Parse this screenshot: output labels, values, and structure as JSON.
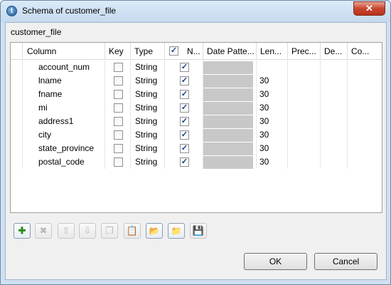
{
  "window": {
    "title": "Schema of customer_file",
    "close_label": "✕"
  },
  "section_label": "customer_file",
  "table": {
    "headers": [
      "Column",
      "Key",
      "Type",
      "N...",
      "Date Patte...",
      "Len...",
      "Prec...",
      "De...",
      "Co..."
    ],
    "header_checkbox_checked": true,
    "rows": [
      {
        "column": "account_num",
        "key": false,
        "type": "String",
        "nullable": true,
        "date_pattern": "",
        "length": "",
        "precision": "",
        "default": "",
        "comment": ""
      },
      {
        "column": "lname",
        "key": false,
        "type": "String",
        "nullable": true,
        "date_pattern": "",
        "length": "30",
        "precision": "",
        "default": "",
        "comment": ""
      },
      {
        "column": "fname",
        "key": false,
        "type": "String",
        "nullable": true,
        "date_pattern": "",
        "length": "30",
        "precision": "",
        "default": "",
        "comment": ""
      },
      {
        "column": "mi",
        "key": false,
        "type": "String",
        "nullable": true,
        "date_pattern": "",
        "length": "30",
        "precision": "",
        "default": "",
        "comment": ""
      },
      {
        "column": "address1",
        "key": false,
        "type": "String",
        "nullable": true,
        "date_pattern": "",
        "length": "30",
        "precision": "",
        "default": "",
        "comment": ""
      },
      {
        "column": "city",
        "key": false,
        "type": "String",
        "nullable": true,
        "date_pattern": "",
        "length": "30",
        "precision": "",
        "default": "",
        "comment": ""
      },
      {
        "column": "state_province",
        "key": false,
        "type": "String",
        "nullable": true,
        "date_pattern": "",
        "length": "30",
        "precision": "",
        "default": "",
        "comment": ""
      },
      {
        "column": "postal_code",
        "key": false,
        "type": "String",
        "nullable": true,
        "date_pattern": "",
        "length": "30",
        "precision": "",
        "default": "",
        "comment": ""
      }
    ]
  },
  "toolbar": {
    "buttons": [
      {
        "icon": "add-icon",
        "glyph": "✚",
        "enabled": true
      },
      {
        "icon": "remove-icon",
        "glyph": "✖",
        "enabled": false
      },
      {
        "icon": "move-up-icon",
        "glyph": "⇧",
        "enabled": false
      },
      {
        "icon": "move-down-icon",
        "glyph": "⇩",
        "enabled": false
      },
      {
        "icon": "copy-icon",
        "glyph": "❐",
        "enabled": false
      },
      {
        "icon": "paste-icon",
        "glyph": "📋",
        "enabled": false
      },
      {
        "icon": "import-icon",
        "glyph": "📂",
        "enabled": true
      },
      {
        "icon": "export-icon",
        "glyph": "📁",
        "enabled": true
      },
      {
        "icon": "save-icon",
        "glyph": "💾",
        "enabled": false
      }
    ]
  },
  "buttons": {
    "ok": "OK",
    "cancel": "Cancel"
  }
}
